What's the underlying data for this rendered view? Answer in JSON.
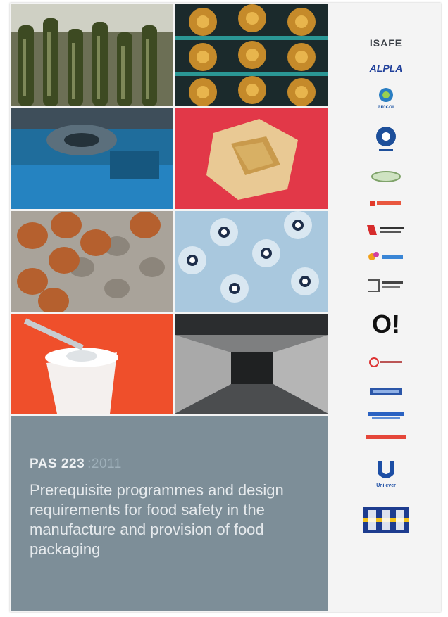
{
  "cover": {
    "standard_code": "PAS 223",
    "standard_year": ":2011",
    "description": "Prerequisite programmes and design requirements for food safety in the manufacture and provision of food packaging"
  },
  "photos": [
    {
      "name": "bottles-photo-icon"
    },
    {
      "name": "capsules-photo-icon"
    },
    {
      "name": "machine-photo-icon"
    },
    {
      "name": "cardboard-box-photo-icon"
    },
    {
      "name": "egg-tray-photo-icon"
    },
    {
      "name": "plastic-lids-photo-icon"
    },
    {
      "name": "yogurt-pot-photo-icon"
    },
    {
      "name": "warehouse-photo-icon"
    }
  ],
  "colors": {
    "panel": "#7d8e98",
    "title_text": "#eef1f3",
    "body_text": "#e6eaed",
    "bsi_blue": "#1d3c8f",
    "bsi_yellow": "#f2c21b"
  },
  "sponsor_logos": [
    {
      "icon": "isafe-logo-icon",
      "text": "ISAFE"
    },
    {
      "icon": "alpla-logo-icon",
      "text": "ALPLA"
    },
    {
      "icon": "amcor-logo-icon",
      "text": "amcor"
    },
    {
      "icon": "sponsor-circle-logo-icon"
    },
    {
      "icon": "sponsor-oval-logo-icon"
    },
    {
      "icon": "sponsor-red-logo-icon"
    },
    {
      "icon": "sponsor-redblack-logo-icon"
    },
    {
      "icon": "sponsor-multicolor-logo-icon"
    },
    {
      "icon": "sponsor-gray-logo-icon"
    },
    {
      "icon": "oi-logo-icon",
      "text": "O!"
    },
    {
      "icon": "sponsor-small-red-logo-icon"
    },
    {
      "icon": "sponsor-blue-logo-icon"
    },
    {
      "icon": "sponsor-blue-text-logo-icon"
    },
    {
      "icon": "sponsor-red-text-logo-icon"
    },
    {
      "icon": "unilever-logo-icon",
      "text": "Unilever"
    },
    {
      "icon": "bsi-logo-icon",
      "text": "BSI"
    }
  ]
}
